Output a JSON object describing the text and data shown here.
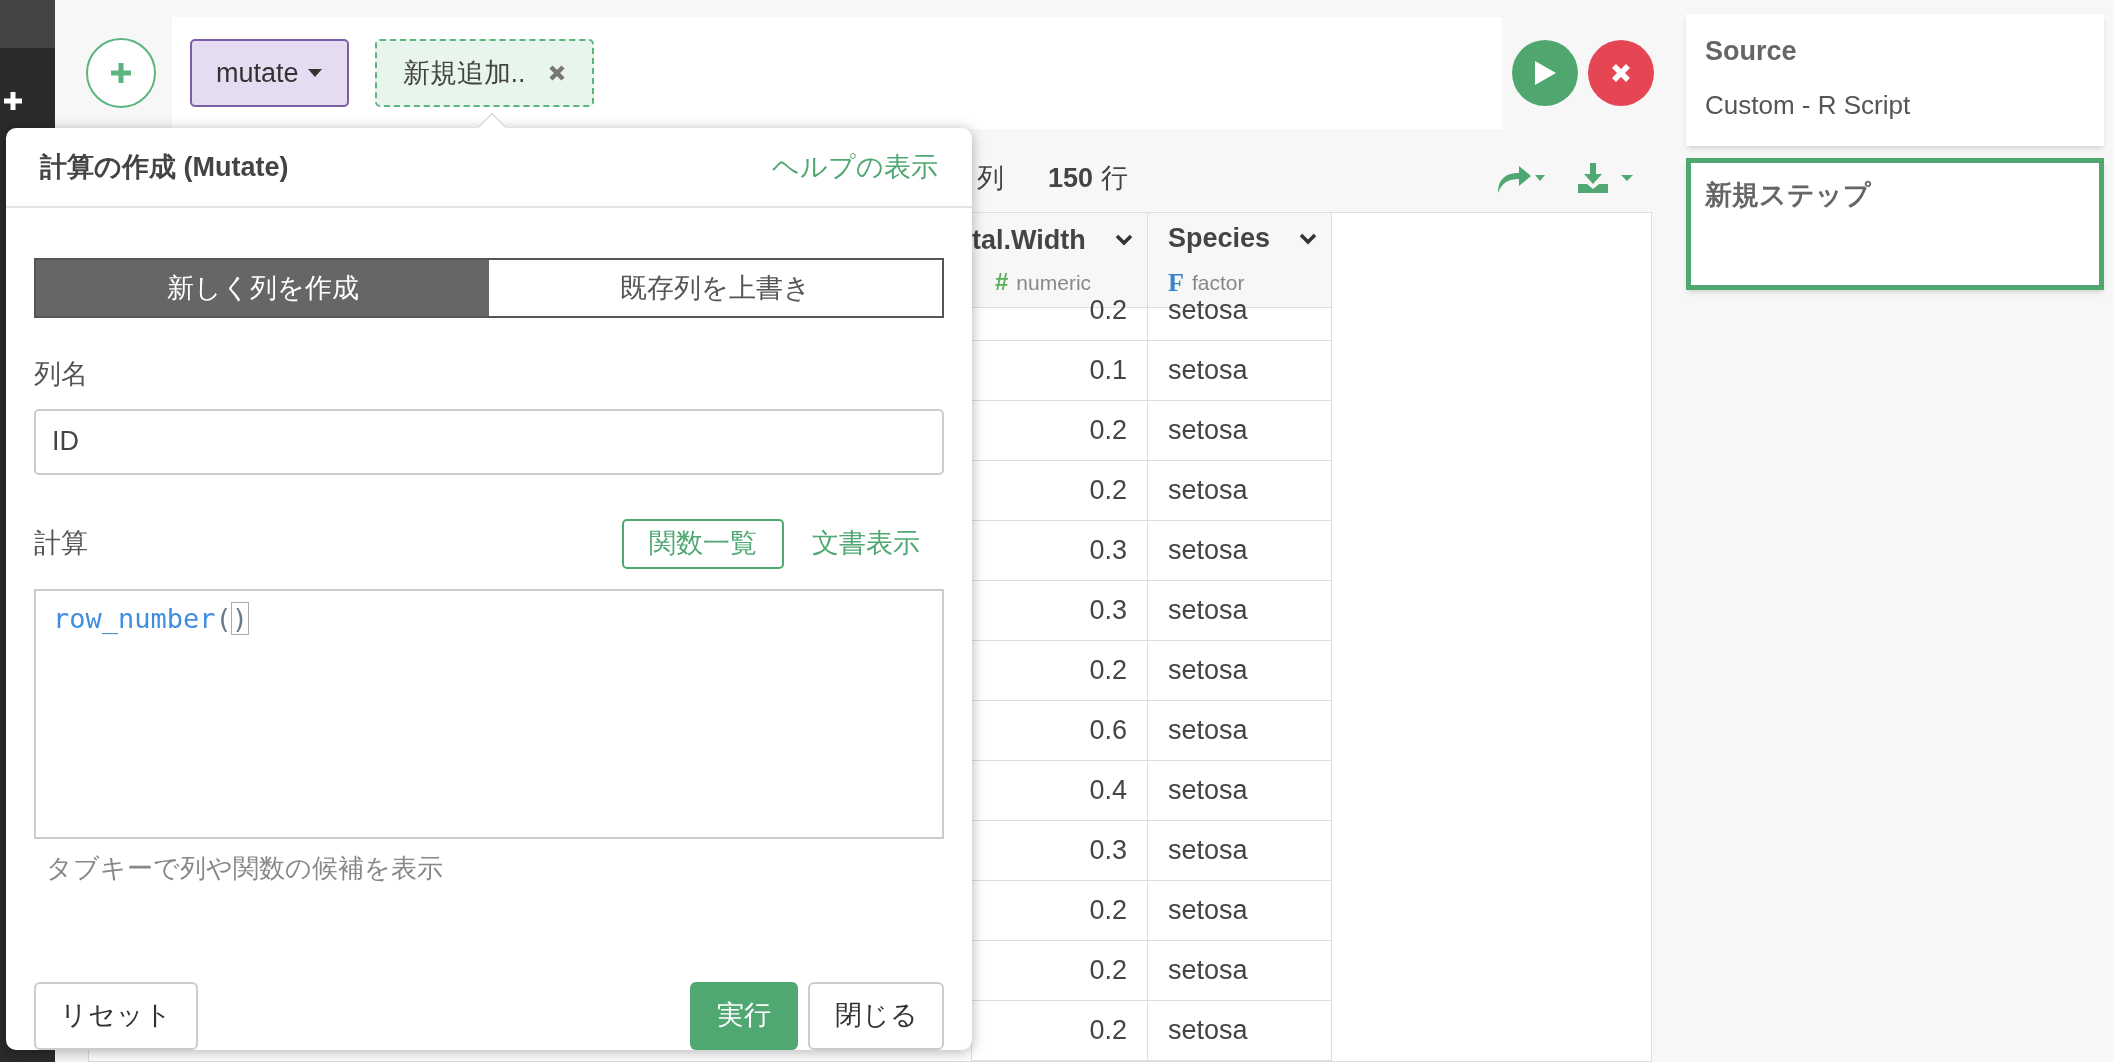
{
  "toolbar": {
    "command": "mutate",
    "step": "新規追加.."
  },
  "stats": {
    "columns_label": "列",
    "rows_count": "150",
    "rows_label": "行"
  },
  "table": {
    "columns": [
      {
        "name": "tal.Width",
        "type_icon": "#",
        "type": "numeric",
        "kind": "numeric"
      },
      {
        "name": "Species",
        "type_icon": "F",
        "type": "factor",
        "kind": "factor"
      }
    ],
    "rows": [
      [
        "0.2",
        "setosa"
      ],
      [
        "0.1",
        "setosa"
      ],
      [
        "0.2",
        "setosa"
      ],
      [
        "0.2",
        "setosa"
      ],
      [
        "0.3",
        "setosa"
      ],
      [
        "0.3",
        "setosa"
      ],
      [
        "0.2",
        "setosa"
      ],
      [
        "0.6",
        "setosa"
      ],
      [
        "0.4",
        "setosa"
      ],
      [
        "0.3",
        "setosa"
      ],
      [
        "0.2",
        "setosa"
      ],
      [
        "0.2",
        "setosa"
      ],
      [
        "0.2",
        "setosa"
      ]
    ]
  },
  "dialog": {
    "title": "計算の作成 (Mutate)",
    "help_link": "ヘルプの表示",
    "modes": [
      {
        "label": "新しく列を作成",
        "selected": true
      },
      {
        "label": "既存列を上書き",
        "selected": false
      }
    ],
    "column_name_label": "列名",
    "column_name_value": "ID",
    "calc_label": "計算",
    "functions_button": "関数一覧",
    "docs_link": "文書表示",
    "code_function": "row_number",
    "code_open": "(",
    "code_close": ")",
    "hint": "タブキーで列や関数の候補を表示",
    "reset_button": "リセット",
    "run_button": "実行",
    "close_button": "閉じる"
  },
  "steps": [
    {
      "title": "Source",
      "subtitle": "Custom - R Script",
      "selected": false
    },
    {
      "title": "新規ステップ",
      "selected": true
    }
  ]
}
